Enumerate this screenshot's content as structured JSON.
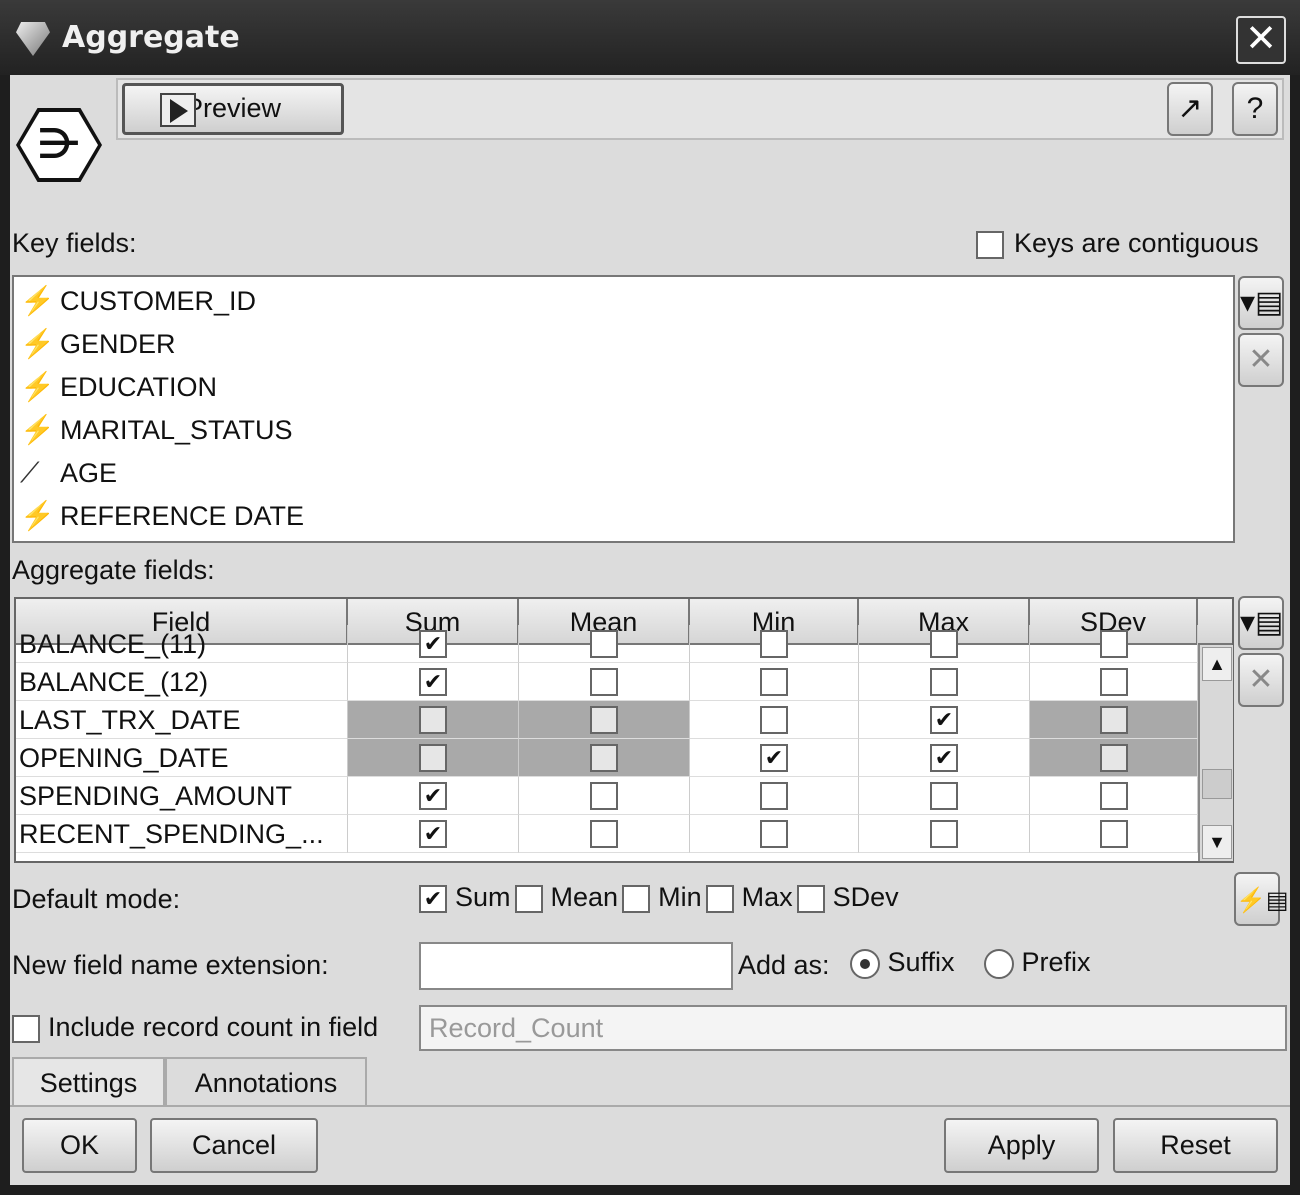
{
  "window": {
    "title": "Aggregate",
    "close_icon": "close-icon"
  },
  "toolbar": {
    "preview_label": "Preview"
  },
  "key_fields": {
    "label": "Key fields:",
    "contiguous_label": "Keys are contiguous",
    "contiguous_checked": false,
    "items": [
      {
        "name": "CUSTOMER_ID",
        "type": "nominal"
      },
      {
        "name": "GENDER",
        "type": "nominal"
      },
      {
        "name": "EDUCATION",
        "type": "nominal"
      },
      {
        "name": "MARITAL_STATUS",
        "type": "nominal"
      },
      {
        "name": "AGE",
        "type": "continuous"
      },
      {
        "name": "REFERENCE DATE",
        "type": "nominal"
      }
    ]
  },
  "aggregate_fields": {
    "label": "Aggregate fields:",
    "columns": [
      "Field",
      "Sum",
      "Mean",
      "Min",
      "Max",
      "SDev"
    ],
    "rows": [
      {
        "field": "BALANCE_(11)",
        "checks": [
          true,
          false,
          false,
          false,
          false
        ],
        "disabled": [
          false,
          false,
          false,
          false,
          false
        ]
      },
      {
        "field": "BALANCE_(12)",
        "checks": [
          true,
          false,
          false,
          false,
          false
        ],
        "disabled": [
          false,
          false,
          false,
          false,
          false
        ]
      },
      {
        "field": "LAST_TRX_DATE",
        "checks": [
          false,
          false,
          false,
          true,
          false
        ],
        "disabled": [
          true,
          true,
          false,
          false,
          true
        ]
      },
      {
        "field": "OPENING_DATE",
        "checks": [
          false,
          false,
          true,
          true,
          false
        ],
        "disabled": [
          true,
          true,
          false,
          false,
          true
        ]
      },
      {
        "field": "SPENDING_AMOUNT",
        "checks": [
          true,
          false,
          false,
          false,
          false
        ],
        "disabled": [
          false,
          false,
          false,
          false,
          false
        ]
      },
      {
        "field": "RECENT_SPENDING_...",
        "checks": [
          true,
          false,
          false,
          false,
          false
        ],
        "disabled": [
          false,
          false,
          false,
          false,
          false
        ]
      }
    ]
  },
  "default_mode": {
    "label": "Default mode:",
    "options": [
      {
        "label": "Sum",
        "checked": true
      },
      {
        "label": "Mean",
        "checked": false
      },
      {
        "label": "Min",
        "checked": false
      },
      {
        "label": "Max",
        "checked": false
      },
      {
        "label": "SDev",
        "checked": false
      }
    ]
  },
  "extension": {
    "label": "New field name extension:",
    "value": "",
    "add_as_label": "Add as:",
    "suffix": "Suffix",
    "prefix": "Prefix",
    "selected": "Suffix"
  },
  "record_count": {
    "label": "Include record count in field",
    "checked": false,
    "value": "Record_Count"
  },
  "tabs": [
    "Settings",
    "Annotations"
  ],
  "buttons": {
    "ok": "OK",
    "cancel": "Cancel",
    "apply": "Apply",
    "reset": "Reset"
  }
}
